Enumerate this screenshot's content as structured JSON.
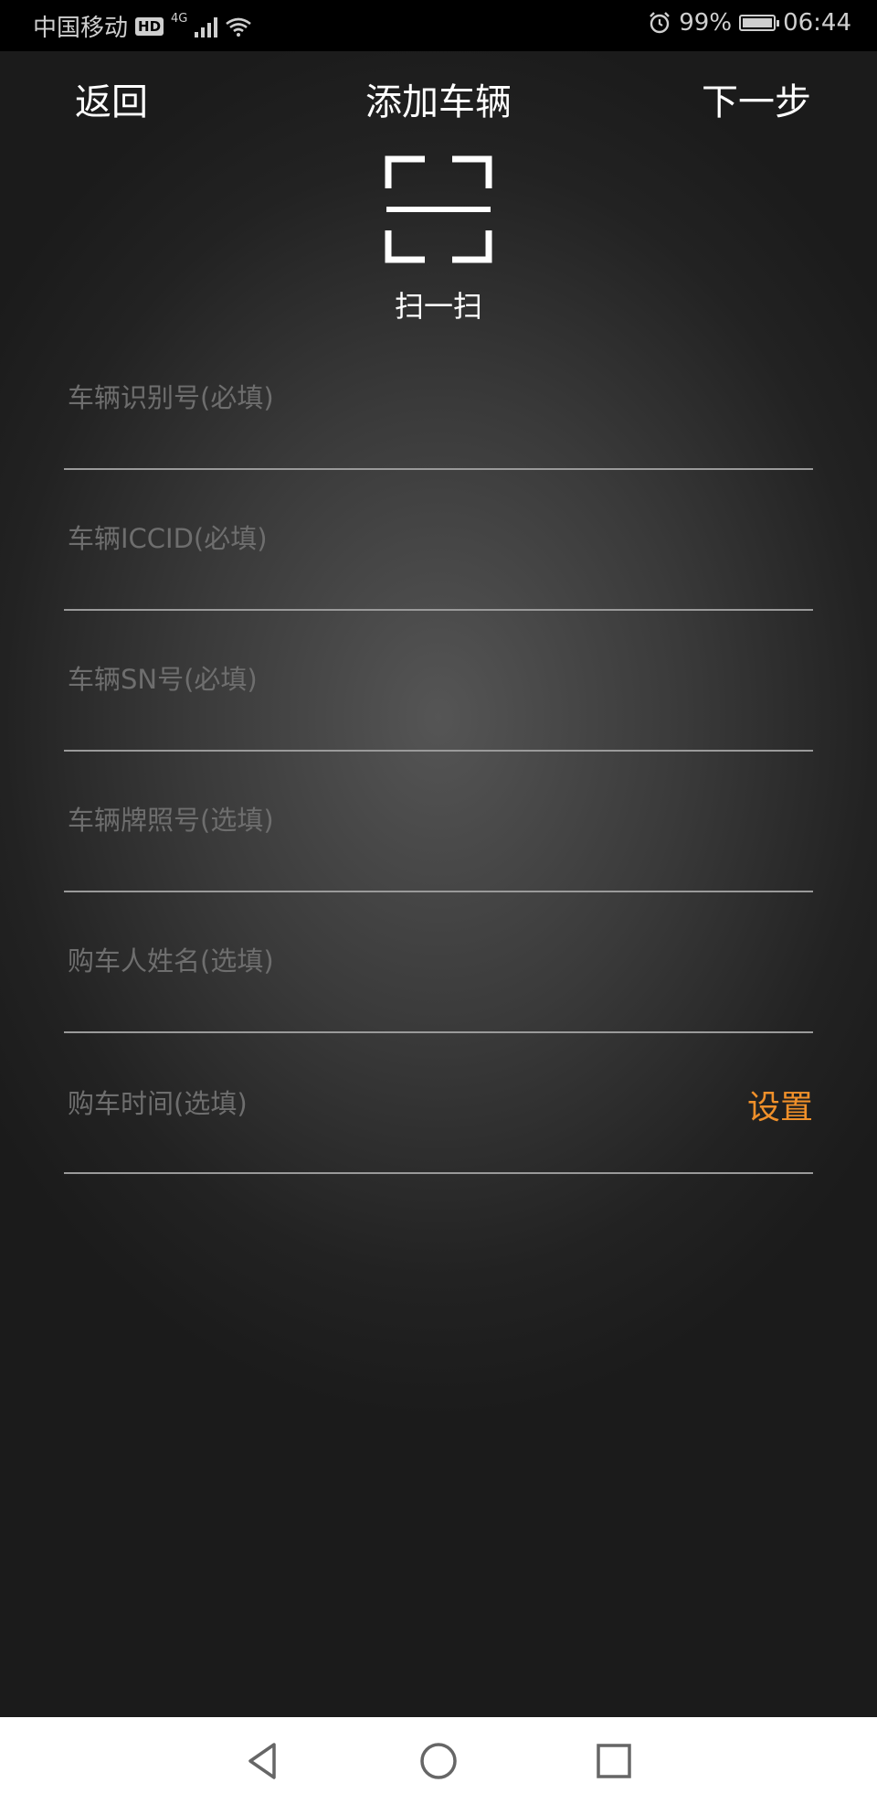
{
  "status_bar": {
    "carrier": "中国移动",
    "hd": "HD",
    "network": "4G",
    "battery": "99%",
    "time": "06:44"
  },
  "header": {
    "back": "返回",
    "title": "添加车辆",
    "next": "下一步"
  },
  "scan": {
    "label": "扫一扫"
  },
  "form": {
    "vin_placeholder": "车辆识别号(必填)",
    "iccid_placeholder": "车辆ICCID(必填)",
    "sn_placeholder": "车辆SN号(必填)",
    "plate_placeholder": "车辆牌照号(选填)",
    "buyer_placeholder": "购车人姓名(选填)",
    "purchase_time_label": "购车时间(选填)",
    "set_label": "设置"
  },
  "colors": {
    "accent": "#f0902a",
    "placeholder": "#6e6e6e",
    "divider": "#9a9a9a"
  },
  "icons": [
    "wifi-icon",
    "alarm-icon",
    "battery-icon",
    "scan-icon",
    "back-triangle-icon",
    "home-circle-icon",
    "recents-square-icon"
  ]
}
